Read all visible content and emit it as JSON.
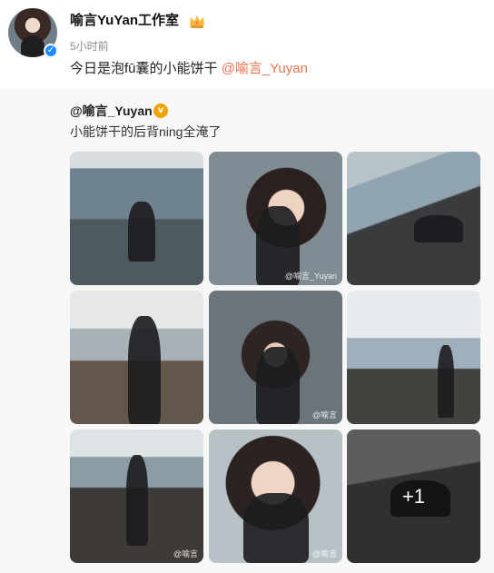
{
  "post": {
    "username": "喻言YuYan工作室",
    "timestamp": "5小时前",
    "text_prefix": "今日是泡fū囊的小能饼干 ",
    "mention": "@喻言_Yuyan"
  },
  "repost": {
    "author": "@喻言_Yuyan",
    "author_badge": "v",
    "text": "小能饼干的后背ning全淹了"
  },
  "images": {
    "more_count": "+1",
    "watermarks": [
      "@喻言_Yuyan",
      "@喻言",
      "@喻言",
      "@喻言"
    ]
  },
  "icons": [
    "avatar",
    "verified-badge-icon",
    "crown-icon",
    "repost-verified-icon"
  ],
  "colors": {
    "mention": "#eb7350",
    "verify_badge": "#1b8cff",
    "repost_badge": "#f4a000",
    "repost_bg": "#f7f7f7"
  }
}
